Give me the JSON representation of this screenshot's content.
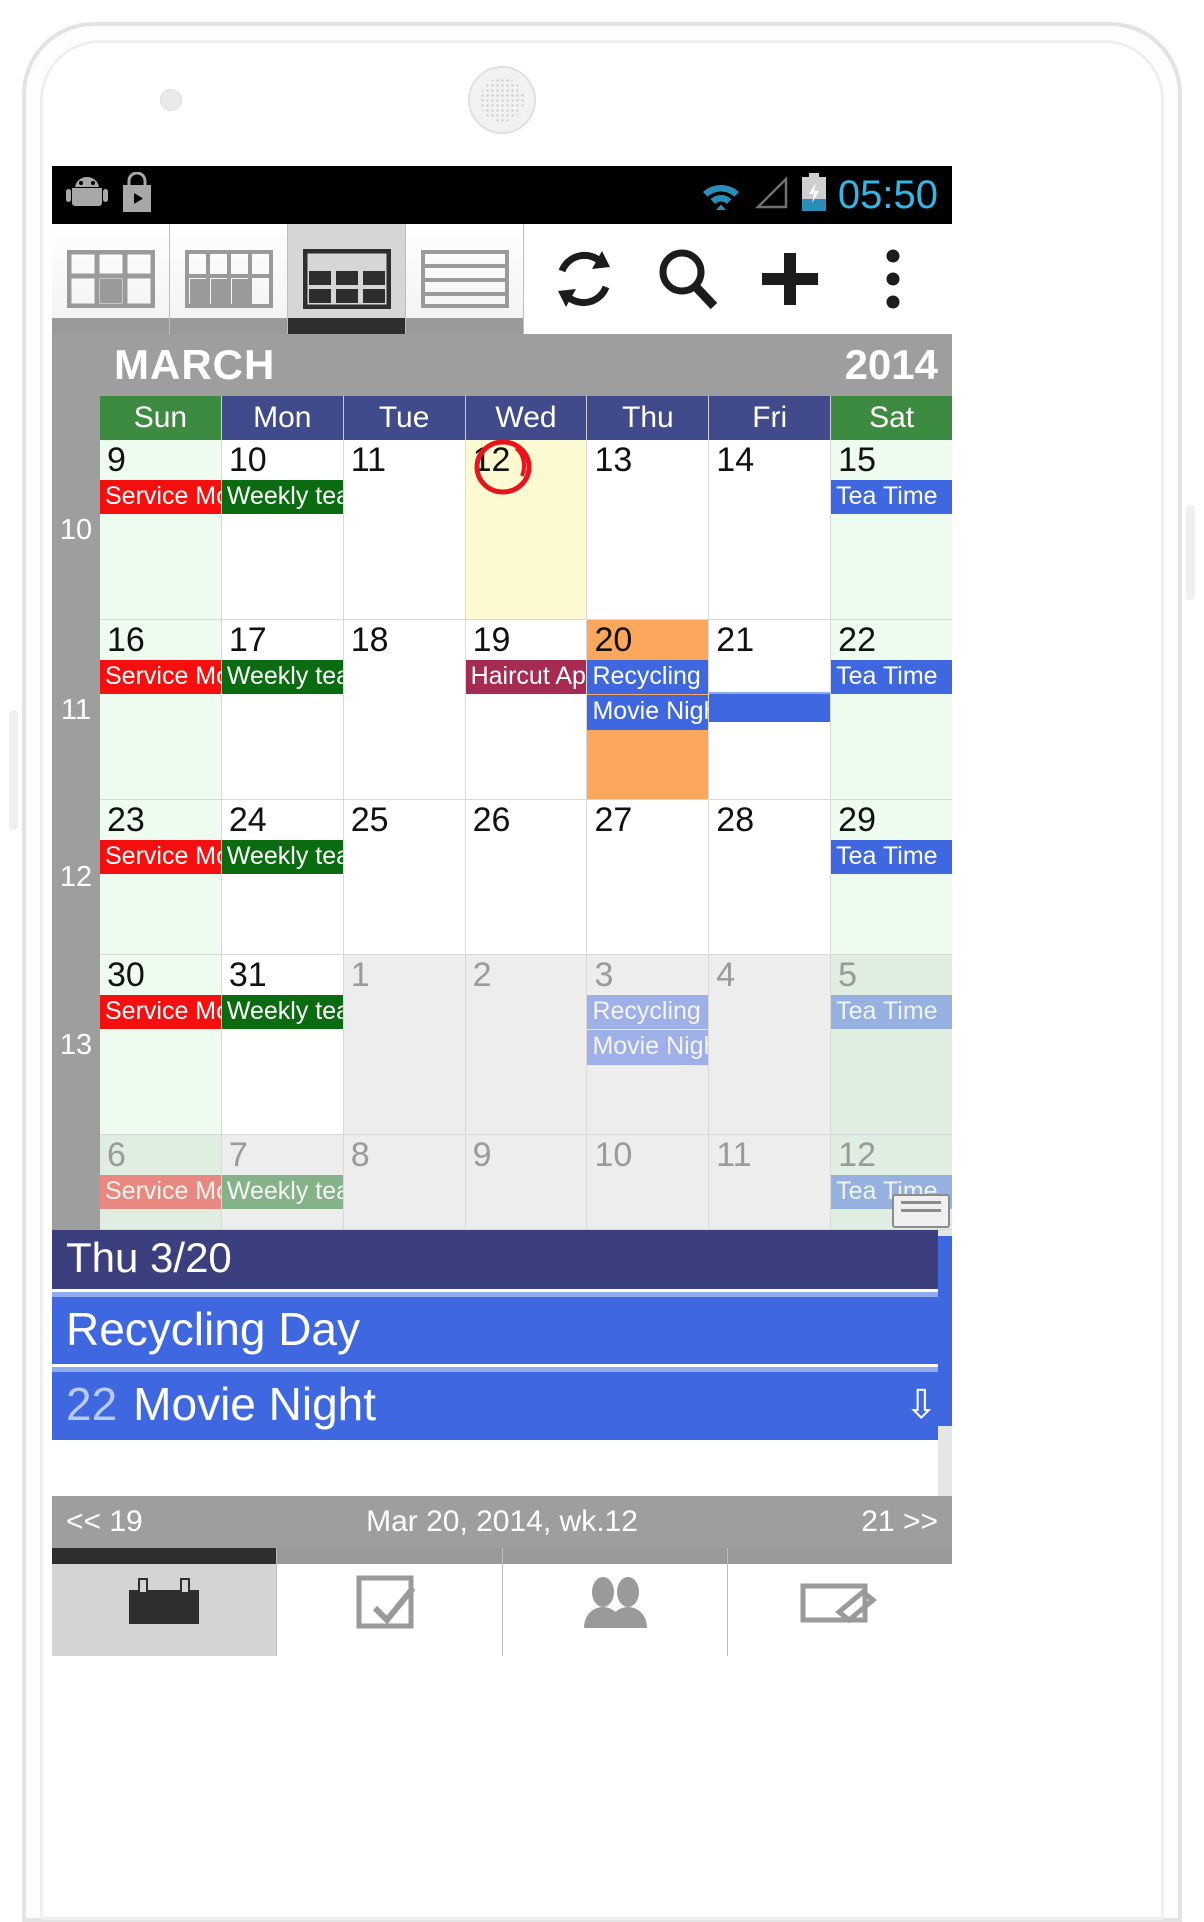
{
  "statusbar": {
    "clock": "05:50",
    "icons": [
      "android-robot-icon",
      "play-store-icon",
      "wifi-icon",
      "cell-signal-icon",
      "battery-charging-icon"
    ]
  },
  "toolbar": {
    "tabs": [
      {
        "name": "view-day-grid",
        "label": "Day grid view",
        "active": false
      },
      {
        "name": "view-week-grid",
        "label": "Week grid view",
        "active": false
      },
      {
        "name": "view-month-grid",
        "label": "Month grid view",
        "active": true
      },
      {
        "name": "view-agenda-list",
        "label": "Agenda list view",
        "active": false
      }
    ],
    "actions": [
      {
        "name": "refresh-button",
        "label": "Refresh",
        "icon": "refresh-icon"
      },
      {
        "name": "search-button",
        "label": "Search",
        "icon": "search-icon"
      },
      {
        "name": "add-event-button",
        "label": "Add event",
        "icon": "plus-icon"
      },
      {
        "name": "overflow-menu-button",
        "label": "More options",
        "icon": "overflow-menu-icon"
      }
    ]
  },
  "month_header": {
    "month": "MARCH",
    "year": "2014"
  },
  "calendar": {
    "weekday_headers": [
      "Sun",
      "Mon",
      "Tue",
      "Wed",
      "Thu",
      "Fri",
      "Sat"
    ],
    "weeks": [
      {
        "week_number": "10",
        "days": [
          {
            "num": "9",
            "state": "sun",
            "events": [
              {
                "title": "Service Mon",
                "color": "#f50f0f"
              }
            ]
          },
          {
            "num": "10",
            "state": "",
            "events": [
              {
                "title": "Weekly tean",
                "color": "#0a6b11"
              }
            ]
          },
          {
            "num": "11",
            "state": "",
            "events": []
          },
          {
            "num": "12",
            "state": "today",
            "events": [],
            "circled": true
          },
          {
            "num": "13",
            "state": "",
            "events": []
          },
          {
            "num": "14",
            "state": "",
            "events": []
          },
          {
            "num": "15",
            "state": "sat",
            "events": [
              {
                "title": "Tea Time",
                "color": "#3f68e0"
              }
            ]
          }
        ]
      },
      {
        "week_number": "11",
        "days": [
          {
            "num": "16",
            "state": "sun",
            "events": [
              {
                "title": "Service Mon",
                "color": "#f50f0f"
              }
            ]
          },
          {
            "num": "17",
            "state": "",
            "events": [
              {
                "title": "Weekly tean",
                "color": "#0a6b11"
              }
            ]
          },
          {
            "num": "18",
            "state": "",
            "events": []
          },
          {
            "num": "19",
            "state": "",
            "events": [
              {
                "title": "Haircut App",
                "color": "#a62b52"
              }
            ]
          },
          {
            "num": "20",
            "state": "selected",
            "events": [
              {
                "title": "Recycling D",
                "color": "#3f68e0"
              },
              {
                "title": "Movie Night",
                "color": "#3f68e0"
              }
            ]
          },
          {
            "num": "21",
            "state": "",
            "events": [],
            "span_continues": "Movie Night"
          },
          {
            "num": "22",
            "state": "sat",
            "events": [
              {
                "title": "Tea Time",
                "color": "#3f68e0"
              }
            ]
          }
        ]
      },
      {
        "week_number": "12",
        "days": [
          {
            "num": "23",
            "state": "sun",
            "events": [
              {
                "title": "Service Mon",
                "color": "#f50f0f"
              }
            ]
          },
          {
            "num": "24",
            "state": "",
            "events": [
              {
                "title": "Weekly tean",
                "color": "#0a6b11"
              }
            ]
          },
          {
            "num": "25",
            "state": "",
            "events": []
          },
          {
            "num": "26",
            "state": "",
            "events": []
          },
          {
            "num": "27",
            "state": "",
            "events": []
          },
          {
            "num": "28",
            "state": "",
            "events": []
          },
          {
            "num": "29",
            "state": "sat",
            "events": [
              {
                "title": "Tea Time",
                "color": "#3f68e0"
              }
            ]
          }
        ]
      },
      {
        "week_number": "13",
        "days": [
          {
            "num": "30",
            "state": "sun",
            "events": [
              {
                "title": "Service Mon",
                "color": "#f50f0f"
              }
            ]
          },
          {
            "num": "31",
            "state": "",
            "events": [
              {
                "title": "Weekly tean",
                "color": "#0a6b11"
              }
            ]
          },
          {
            "num": "1",
            "state": "other",
            "events": []
          },
          {
            "num": "2",
            "state": "other",
            "events": []
          },
          {
            "num": "3",
            "state": "other",
            "events": [
              {
                "title": "Recycling D",
                "color": "#3f68e0",
                "faded": true
              },
              {
                "title": "Movie Night",
                "color": "#3f68e0",
                "faded": true
              }
            ]
          },
          {
            "num": "4",
            "state": "other",
            "events": []
          },
          {
            "num": "5",
            "state": "other sat",
            "events": [
              {
                "title": "Tea Time",
                "color": "#3f68e0",
                "faded": true
              }
            ]
          }
        ]
      },
      {
        "week_number": "",
        "days": [
          {
            "num": "6",
            "state": "other sun",
            "events": [
              {
                "title": "Service Mon",
                "color": "#f50f0f",
                "faded": true
              }
            ]
          },
          {
            "num": "7",
            "state": "other",
            "events": [
              {
                "title": "Weekly tean",
                "color": "#0a6b11",
                "faded": true
              }
            ]
          },
          {
            "num": "8",
            "state": "other",
            "events": []
          },
          {
            "num": "9",
            "state": "other",
            "events": []
          },
          {
            "num": "10",
            "state": "other",
            "events": []
          },
          {
            "num": "11",
            "state": "other",
            "events": []
          },
          {
            "num": "12",
            "state": "other sat",
            "events": [
              {
                "title": "Tea Time",
                "color": "#3f68e0",
                "faded": true
              }
            ]
          }
        ]
      }
    ]
  },
  "detail_panel": {
    "date_header": "Thu 3/20",
    "events": [
      {
        "num": "",
        "title": "Recycling Day",
        "has_arrow": false
      },
      {
        "num": "22",
        "title": "Movie Night",
        "has_arrow": true,
        "arrow_icon": "down-arrow-icon"
      }
    ]
  },
  "footer": {
    "prev_label": "<< 19",
    "center_label": "Mar 20, 2014, wk.12",
    "next_label": "21 >>"
  },
  "bottom_tabs": [
    {
      "name": "bottom-tab-calendar",
      "icon": "calendar-icon",
      "active": true
    },
    {
      "name": "bottom-tab-tasks",
      "icon": "checkbox-icon",
      "active": false
    },
    {
      "name": "bottom-tab-contacts",
      "icon": "contacts-icon",
      "active": false
    },
    {
      "name": "bottom-tab-notes",
      "icon": "note-icon",
      "active": false
    }
  ],
  "colors": {
    "accent_blue": "#3f68e0",
    "header_purple": "#414a8b",
    "weekend_green": "#3d8b40",
    "selected_orange": "#fba85d",
    "today_cream": "#fdfad2",
    "status_cyan": "#33b5e5"
  }
}
